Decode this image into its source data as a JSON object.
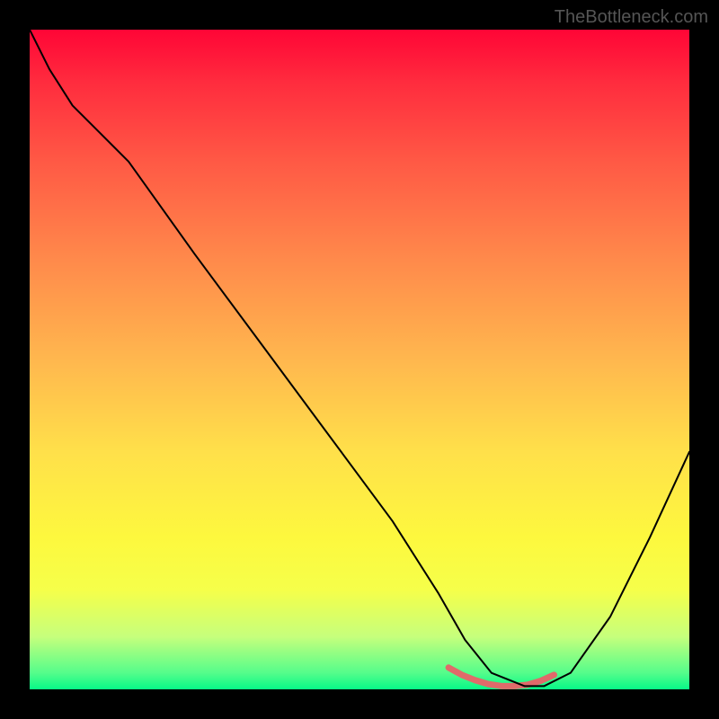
{
  "watermark": "TheBottleneck.com",
  "chart_data": {
    "type": "line",
    "title": "",
    "xlabel": "",
    "ylabel": "",
    "xlim": [
      0,
      100
    ],
    "ylim": [
      0,
      100
    ],
    "grid": false,
    "legend": false,
    "gradient_stops": [
      {
        "pos": 0.0,
        "color": "#ff0536"
      },
      {
        "pos": 0.08,
        "color": "#ff2c3e"
      },
      {
        "pos": 0.2,
        "color": "#ff5945"
      },
      {
        "pos": 0.35,
        "color": "#ff8a4b"
      },
      {
        "pos": 0.5,
        "color": "#ffb74e"
      },
      {
        "pos": 0.64,
        "color": "#ffe04a"
      },
      {
        "pos": 0.77,
        "color": "#fdf83e"
      },
      {
        "pos": 0.85,
        "color": "#f5ff4a"
      },
      {
        "pos": 0.92,
        "color": "#c6ff7c"
      },
      {
        "pos": 0.975,
        "color": "#55fd8b"
      },
      {
        "pos": 1.0,
        "color": "#07f887"
      }
    ],
    "series": [
      {
        "name": "main-curve",
        "color": "#000000",
        "width": 2,
        "x": [
          0.0,
          3.0,
          6.5,
          10.0,
          15.0,
          25.0,
          35.0,
          45.0,
          55.0,
          62.0,
          66.0,
          70.0,
          75.0,
          78.0,
          82.0,
          88.0,
          94.0,
          100.0
        ],
        "y": [
          100.0,
          94.0,
          88.5,
          85.0,
          80.0,
          66.0,
          52.5,
          39.0,
          25.5,
          14.5,
          7.5,
          2.5,
          0.5,
          0.5,
          2.5,
          11.0,
          23.0,
          36.0
        ]
      },
      {
        "name": "valley-highlight",
        "color": "#e06a6a",
        "width": 7,
        "x": [
          63.5,
          65.5,
          67.5,
          69.5,
          71.5,
          73.5,
          75.5,
          77.5,
          79.5
        ],
        "y": [
          3.3,
          2.2,
          1.4,
          0.8,
          0.5,
          0.5,
          0.7,
          1.3,
          2.2
        ]
      }
    ]
  }
}
